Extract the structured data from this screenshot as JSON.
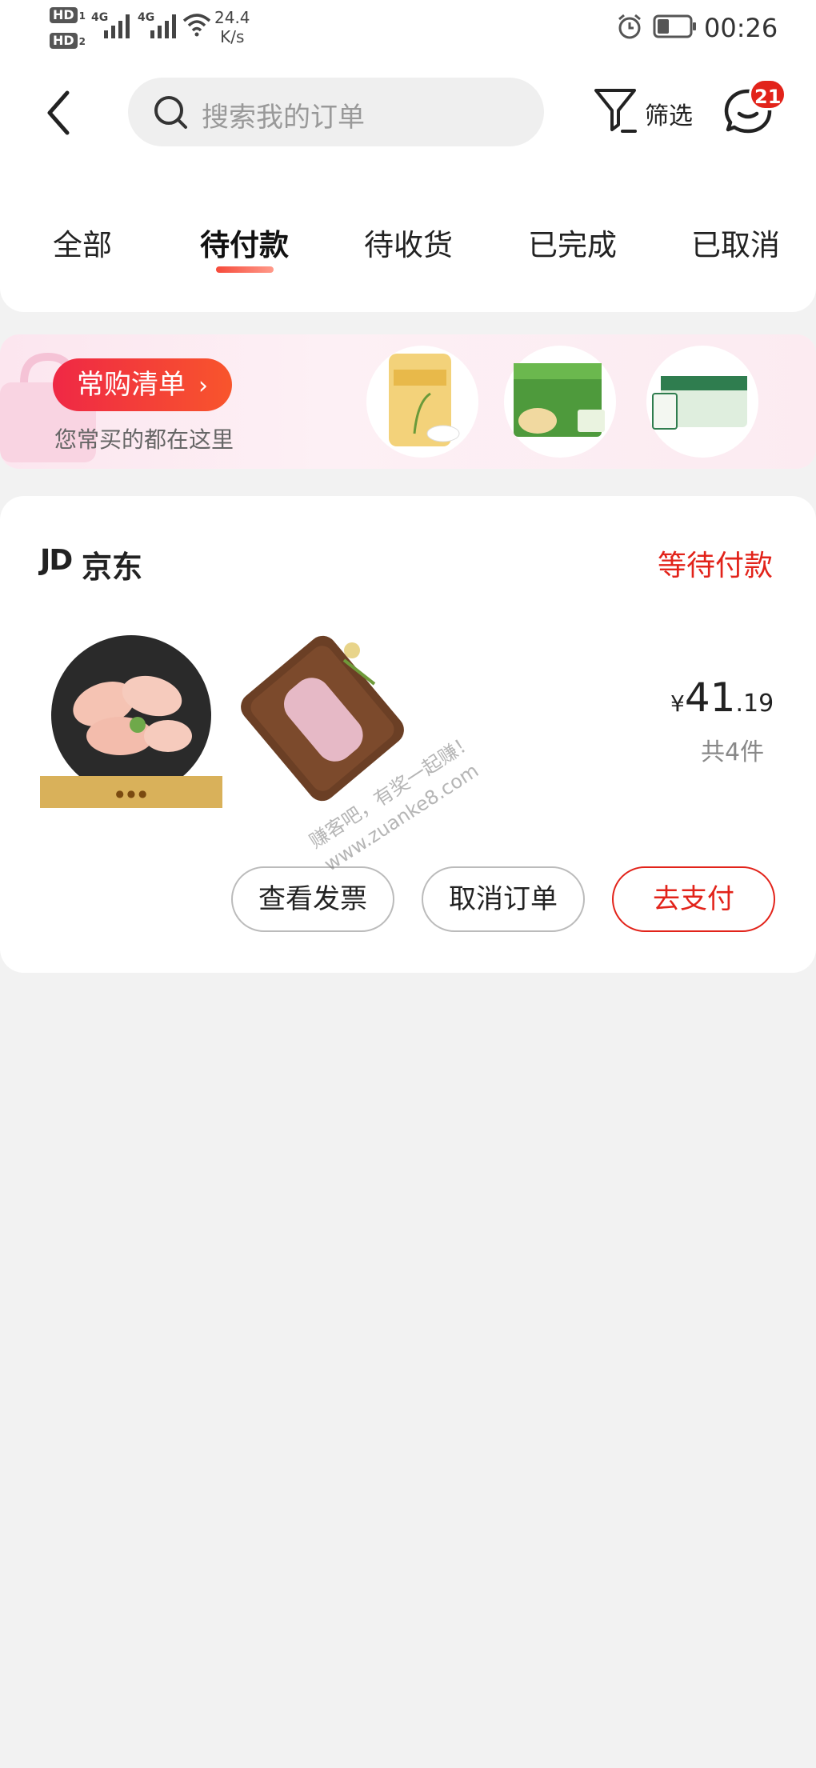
{
  "status_bar": {
    "hd1": "HD",
    "hd1_sub": "1",
    "hd2": "HD",
    "hd2_sub": "2",
    "net1": "4G",
    "net2": "4G",
    "speed_value": "24.4",
    "speed_unit": "K/s",
    "time": "00:26"
  },
  "header": {
    "search_placeholder": "搜索我的订单",
    "filter_label": "筛选",
    "message_badge": "21"
  },
  "tabs": [
    {
      "label": "全部"
    },
    {
      "label": "待付款"
    },
    {
      "label": "待收货"
    },
    {
      "label": "已完成"
    },
    {
      "label": "已取消"
    }
  ],
  "banner": {
    "button_label": "常购清单",
    "subtitle": "您常买的都在这里"
  },
  "order": {
    "shop_logo": "JD",
    "shop_name": "京东",
    "status": "等待付款",
    "price_currency": "¥",
    "price_integer": "41",
    "price_decimal": ".19",
    "quantity": "共4件",
    "actions": {
      "invoice": "查看发票",
      "cancel": "取消订单",
      "pay": "去支付"
    }
  },
  "watermark": {
    "line1": "赚客吧，有奖一起赚！",
    "line2": "www.zuanke8.com"
  },
  "colors": {
    "accent_red": "#e2231a",
    "background": "#f2f2f2"
  },
  "icons": [
    "back-chevron-icon",
    "search-icon",
    "filter-icon",
    "message-icon",
    "alarm-icon",
    "battery-icon",
    "wifi-icon",
    "signal-icon",
    "chevron-right-icon"
  ]
}
